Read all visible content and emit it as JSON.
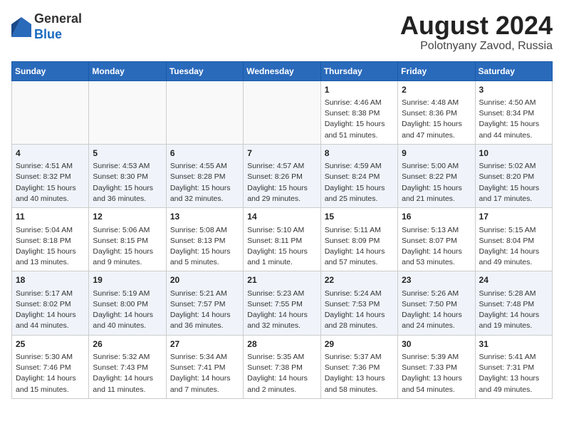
{
  "header": {
    "logo_general": "General",
    "logo_blue": "Blue",
    "month_title": "August 2024",
    "location": "Polotnyany Zavod, Russia"
  },
  "weekdays": [
    "Sunday",
    "Monday",
    "Tuesday",
    "Wednesday",
    "Thursday",
    "Friday",
    "Saturday"
  ],
  "weeks": [
    [
      {
        "day": "",
        "text": ""
      },
      {
        "day": "",
        "text": ""
      },
      {
        "day": "",
        "text": ""
      },
      {
        "day": "",
        "text": ""
      },
      {
        "day": "1",
        "text": "Sunrise: 4:46 AM\nSunset: 8:38 PM\nDaylight: 15 hours and 51 minutes."
      },
      {
        "day": "2",
        "text": "Sunrise: 4:48 AM\nSunset: 8:36 PM\nDaylight: 15 hours and 47 minutes."
      },
      {
        "day": "3",
        "text": "Sunrise: 4:50 AM\nSunset: 8:34 PM\nDaylight: 15 hours and 44 minutes."
      }
    ],
    [
      {
        "day": "4",
        "text": "Sunrise: 4:51 AM\nSunset: 8:32 PM\nDaylight: 15 hours and 40 minutes."
      },
      {
        "day": "5",
        "text": "Sunrise: 4:53 AM\nSunset: 8:30 PM\nDaylight: 15 hours and 36 minutes."
      },
      {
        "day": "6",
        "text": "Sunrise: 4:55 AM\nSunset: 8:28 PM\nDaylight: 15 hours and 32 minutes."
      },
      {
        "day": "7",
        "text": "Sunrise: 4:57 AM\nSunset: 8:26 PM\nDaylight: 15 hours and 29 minutes."
      },
      {
        "day": "8",
        "text": "Sunrise: 4:59 AM\nSunset: 8:24 PM\nDaylight: 15 hours and 25 minutes."
      },
      {
        "day": "9",
        "text": "Sunrise: 5:00 AM\nSunset: 8:22 PM\nDaylight: 15 hours and 21 minutes."
      },
      {
        "day": "10",
        "text": "Sunrise: 5:02 AM\nSunset: 8:20 PM\nDaylight: 15 hours and 17 minutes."
      }
    ],
    [
      {
        "day": "11",
        "text": "Sunrise: 5:04 AM\nSunset: 8:18 PM\nDaylight: 15 hours and 13 minutes."
      },
      {
        "day": "12",
        "text": "Sunrise: 5:06 AM\nSunset: 8:15 PM\nDaylight: 15 hours and 9 minutes."
      },
      {
        "day": "13",
        "text": "Sunrise: 5:08 AM\nSunset: 8:13 PM\nDaylight: 15 hours and 5 minutes."
      },
      {
        "day": "14",
        "text": "Sunrise: 5:10 AM\nSunset: 8:11 PM\nDaylight: 15 hours and 1 minute."
      },
      {
        "day": "15",
        "text": "Sunrise: 5:11 AM\nSunset: 8:09 PM\nDaylight: 14 hours and 57 minutes."
      },
      {
        "day": "16",
        "text": "Sunrise: 5:13 AM\nSunset: 8:07 PM\nDaylight: 14 hours and 53 minutes."
      },
      {
        "day": "17",
        "text": "Sunrise: 5:15 AM\nSunset: 8:04 PM\nDaylight: 14 hours and 49 minutes."
      }
    ],
    [
      {
        "day": "18",
        "text": "Sunrise: 5:17 AM\nSunset: 8:02 PM\nDaylight: 14 hours and 44 minutes."
      },
      {
        "day": "19",
        "text": "Sunrise: 5:19 AM\nSunset: 8:00 PM\nDaylight: 14 hours and 40 minutes."
      },
      {
        "day": "20",
        "text": "Sunrise: 5:21 AM\nSunset: 7:57 PM\nDaylight: 14 hours and 36 minutes."
      },
      {
        "day": "21",
        "text": "Sunrise: 5:23 AM\nSunset: 7:55 PM\nDaylight: 14 hours and 32 minutes."
      },
      {
        "day": "22",
        "text": "Sunrise: 5:24 AM\nSunset: 7:53 PM\nDaylight: 14 hours and 28 minutes."
      },
      {
        "day": "23",
        "text": "Sunrise: 5:26 AM\nSunset: 7:50 PM\nDaylight: 14 hours and 24 minutes."
      },
      {
        "day": "24",
        "text": "Sunrise: 5:28 AM\nSunset: 7:48 PM\nDaylight: 14 hours and 19 minutes."
      }
    ],
    [
      {
        "day": "25",
        "text": "Sunrise: 5:30 AM\nSunset: 7:46 PM\nDaylight: 14 hours and 15 minutes."
      },
      {
        "day": "26",
        "text": "Sunrise: 5:32 AM\nSunset: 7:43 PM\nDaylight: 14 hours and 11 minutes."
      },
      {
        "day": "27",
        "text": "Sunrise: 5:34 AM\nSunset: 7:41 PM\nDaylight: 14 hours and 7 minutes."
      },
      {
        "day": "28",
        "text": "Sunrise: 5:35 AM\nSunset: 7:38 PM\nDaylight: 14 hours and 2 minutes."
      },
      {
        "day": "29",
        "text": "Sunrise: 5:37 AM\nSunset: 7:36 PM\nDaylight: 13 hours and 58 minutes."
      },
      {
        "day": "30",
        "text": "Sunrise: 5:39 AM\nSunset: 7:33 PM\nDaylight: 13 hours and 54 minutes."
      },
      {
        "day": "31",
        "text": "Sunrise: 5:41 AM\nSunset: 7:31 PM\nDaylight: 13 hours and 49 minutes."
      }
    ]
  ]
}
